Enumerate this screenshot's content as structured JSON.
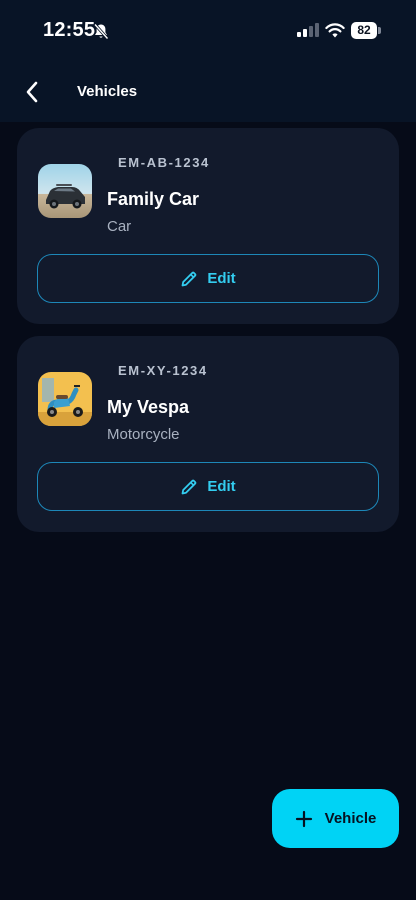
{
  "status_bar": {
    "time": "12:55",
    "battery_level": "82",
    "icons": [
      "bell-slash-icon",
      "cellular-signal-icon",
      "wifi-icon",
      "battery-icon"
    ]
  },
  "header": {
    "title": "Vehicles",
    "back_icon": "chevron-left-icon"
  },
  "vehicles": [
    {
      "plate": "EM-AB-1234",
      "name": "Family Car",
      "type": "Car",
      "edit_label": "Edit",
      "edit_icon": "pencil-icon",
      "thumbnail": "car-photo"
    },
    {
      "plate": "EM-XY-1234",
      "name": "My Vespa",
      "type": "Motorcycle",
      "edit_label": "Edit",
      "edit_icon": "pencil-icon",
      "thumbnail": "scooter-photo"
    }
  ],
  "fab": {
    "label": "Vehicle",
    "icon": "plus-icon"
  },
  "colors": {
    "background": "#060b18",
    "header": "#081426",
    "card": "#121a2c",
    "accent": "#00d3f5",
    "edit_text": "#33cdf0",
    "edit_border": "#1d87b8"
  }
}
